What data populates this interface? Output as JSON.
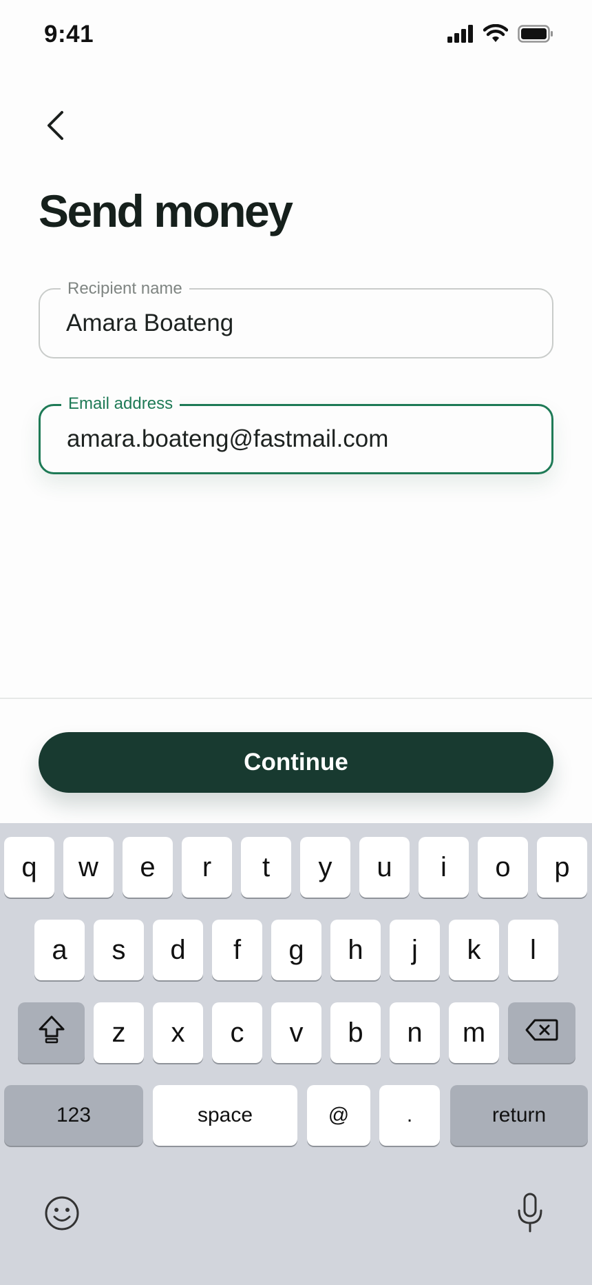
{
  "status_bar": {
    "time": "9:41",
    "icons": [
      "cellular-signal-icon",
      "wifi-icon",
      "battery-icon"
    ]
  },
  "header": {
    "back_icon": "chevron-left-icon",
    "title": "Send money"
  },
  "form": {
    "recipient": {
      "label": "Recipient name",
      "value": "Amara Boateng"
    },
    "email": {
      "label": "Email address",
      "value": "amara.boateng@fastmail.com",
      "focused": true
    }
  },
  "actions": {
    "continue_label": "Continue"
  },
  "keyboard": {
    "row1": [
      "q",
      "w",
      "e",
      "r",
      "t",
      "y",
      "u",
      "i",
      "o",
      "p"
    ],
    "row2": [
      "a",
      "s",
      "d",
      "f",
      "g",
      "h",
      "j",
      "k",
      "l"
    ],
    "row3": [
      "z",
      "x",
      "c",
      "v",
      "b",
      "n",
      "m"
    ],
    "numbers_label": "123",
    "space_label": "space",
    "at_label": "@",
    "dot_label": ".",
    "return_label": "return",
    "icons": [
      "shift-icon",
      "delete-icon",
      "emoji-icon",
      "microphone-icon"
    ]
  },
  "colors": {
    "accent": "#1e7a56",
    "button": "#183a30",
    "keyboard_bg": "#d2d5dc"
  }
}
